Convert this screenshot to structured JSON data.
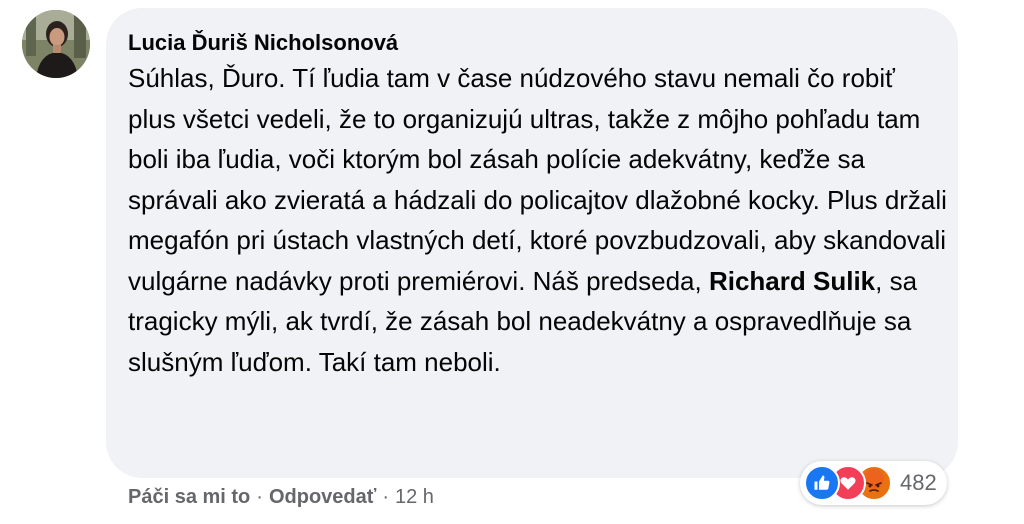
{
  "comment": {
    "author": "Lucia Ďuriš Nicholsonová",
    "text_part1": "Súhlas, Ďuro. Tí ľudia tam v čase núdzového stavu nemali čo robiť plus všetci vedeli, že to organizujú ultras, takže z môjho pohľadu tam boli iba ľudia, voči ktorým bol zásah polície adekvátny, keďže sa správali ako zvieratá a hádzali do policajtov dlažobné kocky. Plus držali megafón pri ústach vlastných detí, ktoré povzbudzovali, aby skandovali vulgárne nadávky proti premiérovi. Náš predseda, ",
    "mention": "Richard Sulik",
    "text_part2": ", sa tragicky mýli, ak tvrdí, že zásah bol neadekvátny a ospravedlňuje sa slušným ľuďom. Takí tam neboli."
  },
  "reactions": {
    "icons": [
      "like-icon",
      "love-icon",
      "angry-icon"
    ],
    "count": "482"
  },
  "actions": {
    "like": "Páči sa mi to",
    "separator": "·",
    "reply": "Odpovedať",
    "time": "12 h"
  },
  "colors": {
    "bubble": "#f0f2f5",
    "text": "#050505",
    "secondary": "#65676b",
    "like": "#1877f2",
    "love": "#f33e58",
    "angry": "#e9710f"
  }
}
